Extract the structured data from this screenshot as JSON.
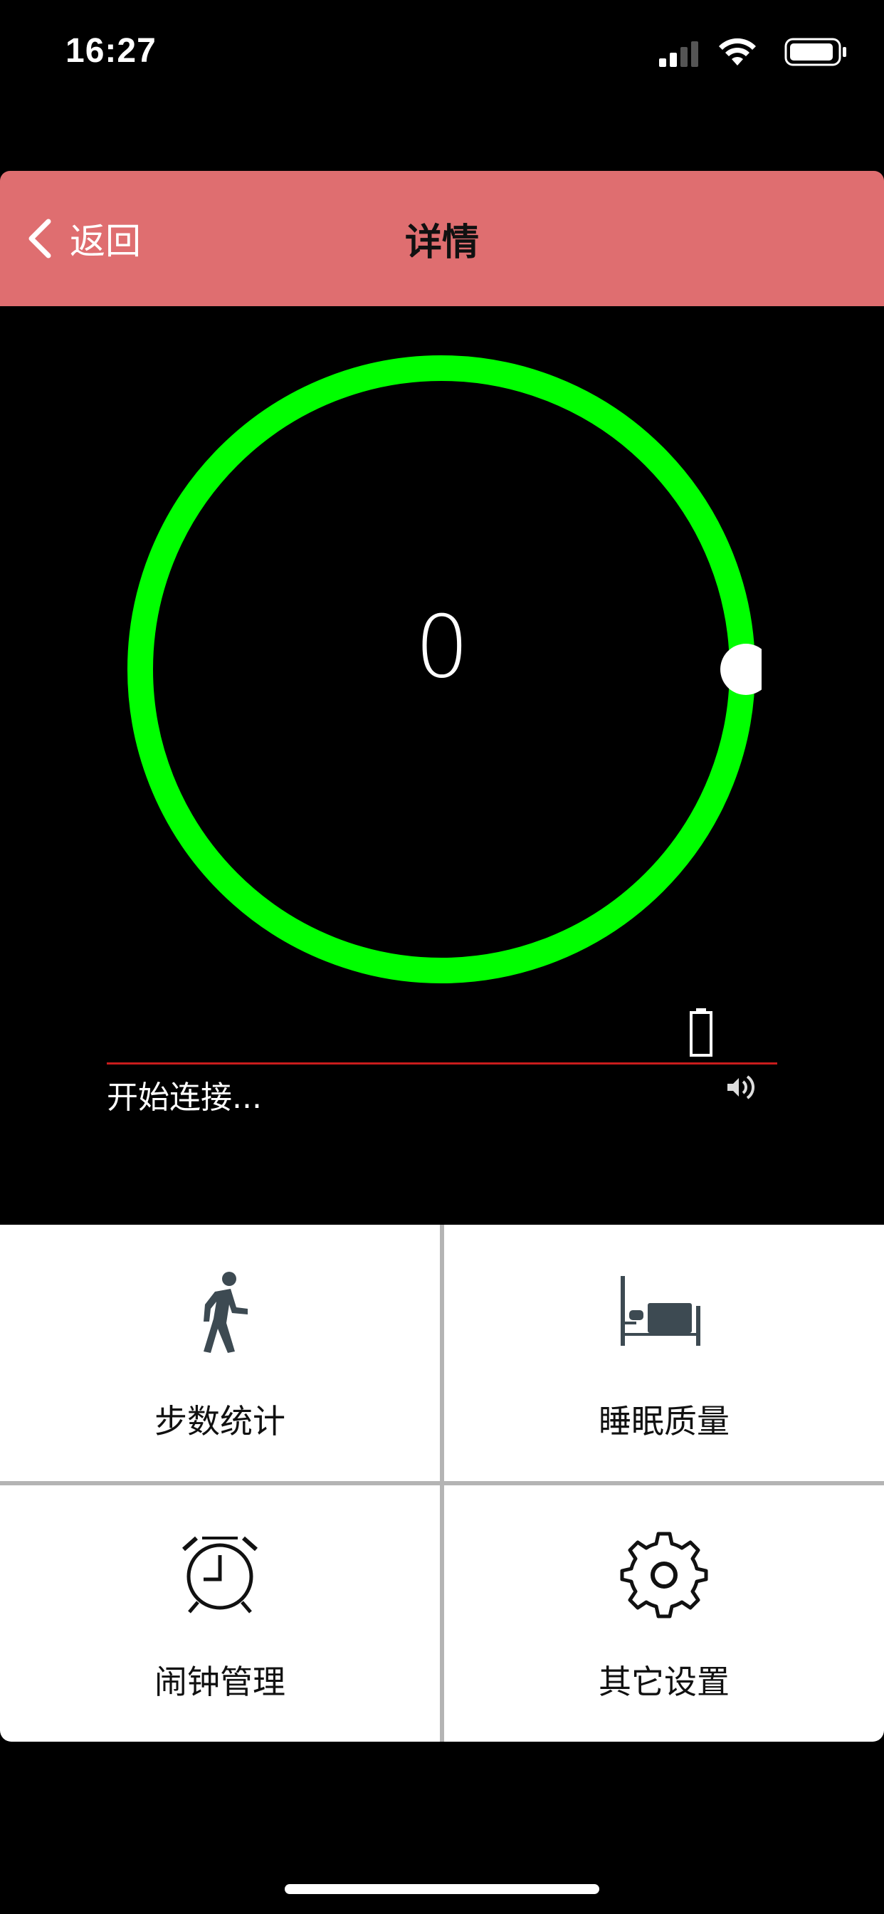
{
  "status_bar": {
    "time": "16:27"
  },
  "nav": {
    "back_label": "返回",
    "title": "详情"
  },
  "ring": {
    "value": "0",
    "ring_color": "#00ff00",
    "knob_color": "#ffffff"
  },
  "connection": {
    "status_text": "开始连接...",
    "divider_color": "#c81c1c"
  },
  "menu": {
    "items": [
      {
        "label": "步数统计",
        "icon": "walking-person-icon"
      },
      {
        "label": "睡眠质量",
        "icon": "bed-icon"
      },
      {
        "label": "闹钟管理",
        "icon": "alarm-clock-icon"
      },
      {
        "label": "其它设置",
        "icon": "gear-icon"
      }
    ]
  },
  "colors": {
    "nav_background": "#df6e70",
    "background": "#000000",
    "tile_background": "#ffffff",
    "icon_color": "#3d4a52"
  }
}
